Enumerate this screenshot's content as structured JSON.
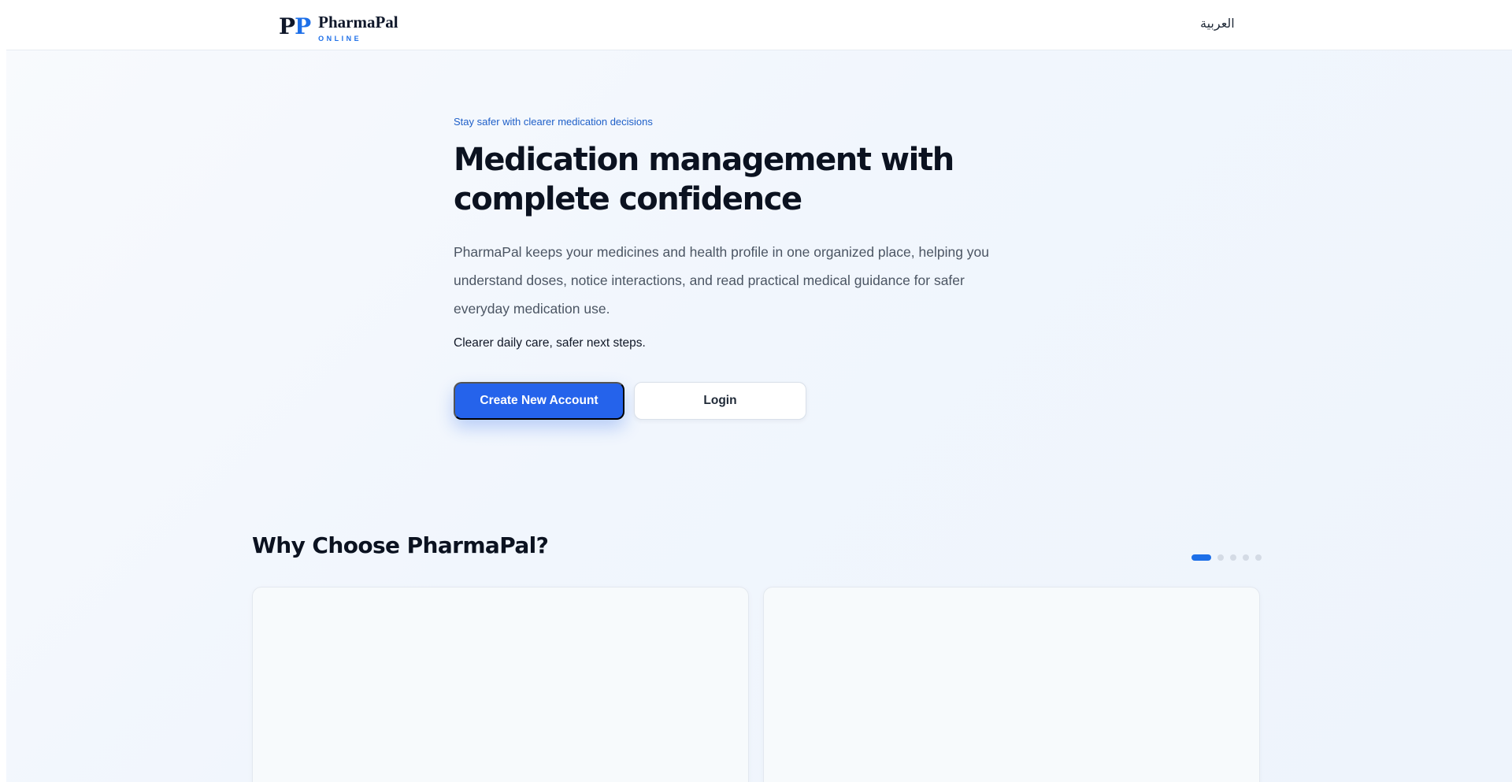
{
  "header": {
    "logo_mark_left": "P",
    "logo_mark_right": "P",
    "brand_name": "PharmaPal",
    "brand_sub": "ONLINE",
    "language_link": "العربية"
  },
  "hero": {
    "eyebrow": "Stay safer with clearer medication decisions",
    "title": "Medication management with complete confidence",
    "description": "PharmaPal keeps your medicines and health profile in one organized place, helping you understand doses, notice interactions, and read practical medical guidance for safer everyday medication use.",
    "note": "Clearer daily care, safer next steps.",
    "primary_button": "Create New Account",
    "secondary_button": "Login"
  },
  "features": {
    "title": "Why Choose PharmaPal?",
    "carousel": {
      "slide_count": 5,
      "active_index": 0
    }
  },
  "colors": {
    "accent": "#2563eb",
    "brand_blue": "#1d6fe8",
    "heading": "#0b1220",
    "body_text": "#4b5563"
  }
}
